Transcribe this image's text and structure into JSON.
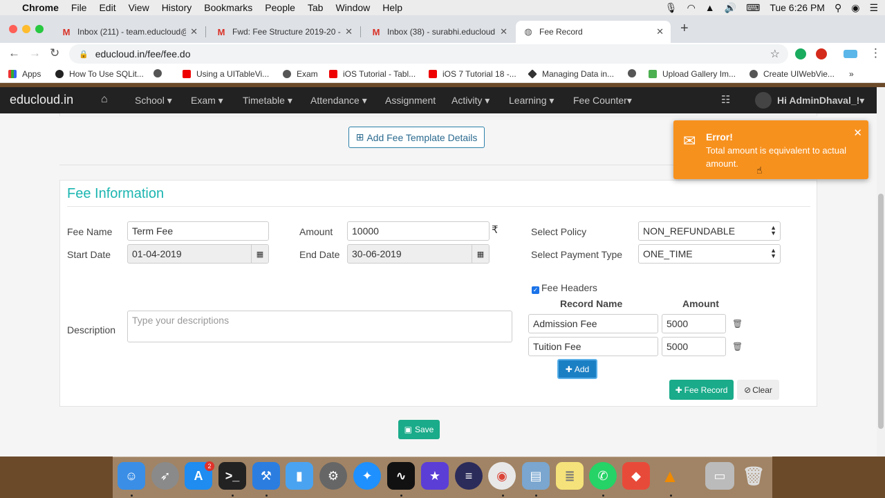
{
  "menubar": {
    "app": "Chrome",
    "items": [
      "File",
      "Edit",
      "View",
      "History",
      "Bookmarks",
      "People",
      "Tab",
      "Window",
      "Help"
    ],
    "clock": "Tue 6:26 PM"
  },
  "tabs": [
    {
      "label": "Inbox (211) - team.educloud@",
      "icon": "gmail-icon"
    },
    {
      "label": "Fwd: Fee Structure 2019-20 -",
      "icon": "gmail-icon"
    },
    {
      "label": "Inbox (38) - surabhi.educloud@",
      "icon": "gmail-icon"
    },
    {
      "label": "Fee Record",
      "icon": "globe-icon",
      "active": true
    }
  ],
  "url": "educloud.in/fee/fee.do",
  "bookmarks": [
    "Apps",
    "How To Use SQLit...",
    "",
    "Using a UITableVi...",
    "Exam",
    "iOS Tutorial - Tabl...",
    "iOS 7 Tutorial 18 -...",
    "Managing Data in...",
    "",
    "Upload Gallery Im...",
    "Create UIWebVie..."
  ],
  "appnav": {
    "brand": "educloud.in",
    "items": [
      "School ▾",
      "Exam ▾",
      "Timetable ▾",
      "Attendance ▾",
      "Assignment",
      "Activity ▾",
      "Learning ▾",
      "Fee Counter▾"
    ],
    "user": "Hi AdminDhaval_!▾"
  },
  "add_template_label": "Add Fee Template Details",
  "fee_info": {
    "title": "Fee Information",
    "fee_name_label": "Fee Name",
    "fee_name_value": "Term Fee",
    "amount_label": "Amount",
    "amount_value": "10000",
    "currency_symbol": "₹",
    "start_date_label": "Start Date",
    "start_date_value": "01-04-2019",
    "end_date_label": "End Date",
    "end_date_value": "30-06-2019",
    "policy_label": "Select Policy",
    "policy_value": "NON_REFUNDABLE",
    "payment_type_label": "Select Payment Type",
    "payment_type_value": "ONE_TIME",
    "description_label": "Description",
    "description_placeholder": "Type your descriptions",
    "fee_headers_label": "Fee Headers",
    "fee_headers_checked": true,
    "col_record_name": "Record Name",
    "col_amount": "Amount",
    "rows": [
      {
        "name": "Admission Fee",
        "amount": "5000"
      },
      {
        "name": "Tuition Fee",
        "amount": "5000"
      }
    ],
    "add_label": "Add",
    "fee_record_label": "Fee Record",
    "clear_label": "Clear"
  },
  "save_label": "Save",
  "toast": {
    "title": "Error!",
    "message": "Total amount is equivalent to actual amount.",
    "color": "#f7911e"
  },
  "colors": {
    "accent_teal": "#1bb5b0",
    "success": "#1aab8a",
    "primary": "#1b7fc4",
    "navbar": "#222222"
  }
}
